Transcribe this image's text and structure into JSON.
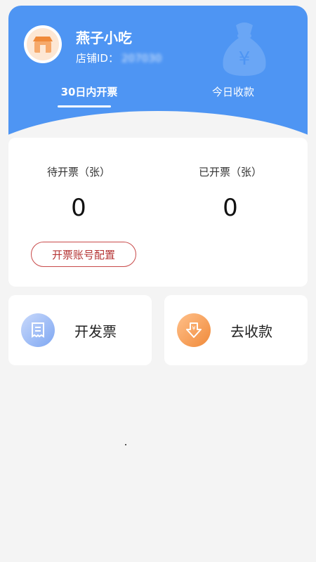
{
  "header": {
    "shop_name": "燕子小吃",
    "shop_id_label": "店铺ID：",
    "shop_id_value": "207030",
    "tabs": [
      {
        "label": "30日内开票",
        "active": true
      },
      {
        "label": "今日收款",
        "active": false
      }
    ],
    "accent_color": "#4e95f3"
  },
  "stats": {
    "pending_label": "待开票（张）",
    "pending_value": "0",
    "issued_label": "已开票（张）",
    "issued_value": "0",
    "config_button": "开票账号配置"
  },
  "actions": {
    "issue_invoice": "开发票",
    "collect_payment": "去收款"
  },
  "icons": [
    "shop-avatar-icon",
    "money-bag-icon",
    "invoice-icon",
    "payment-icon"
  ]
}
